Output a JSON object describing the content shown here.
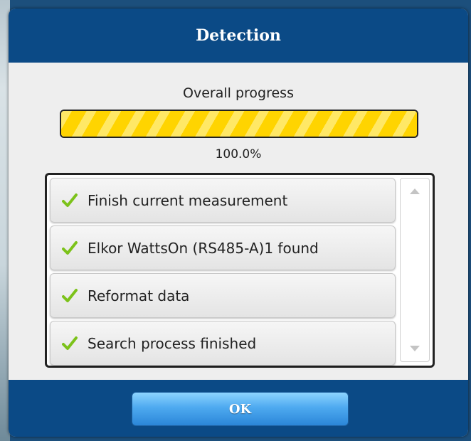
{
  "dialog": {
    "title": "Detection",
    "ok_label": "OK"
  },
  "progress": {
    "label": "Overall progress",
    "percent_text": "100.0%",
    "value": 100
  },
  "tasks": [
    {
      "label": "Finish current measurement",
      "status": "done",
      "icon": "check-icon"
    },
    {
      "label": "Elkor WattsOn (RS485-A)1 found",
      "status": "done",
      "icon": "check-icon"
    },
    {
      "label": "Reformat data",
      "status": "done",
      "icon": "check-icon"
    },
    {
      "label": "Search process finished",
      "status": "done",
      "icon": "check-icon"
    }
  ],
  "colors": {
    "header": "#0b4a86",
    "progress_fill": "#ffd400",
    "check": "#7cc21a",
    "ok_button": "#4eaaf0"
  }
}
